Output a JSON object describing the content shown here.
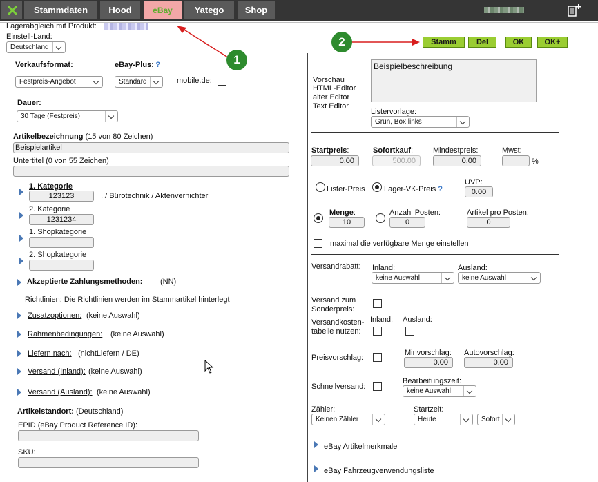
{
  "tabs": [
    {
      "label": "Stammdaten"
    },
    {
      "label": "Hood"
    },
    {
      "label": "eBay"
    },
    {
      "label": "Yatego"
    },
    {
      "label": "Shop"
    }
  ],
  "header": {
    "lagerabgleich_label": "Lagerabgleich mit Produkt:",
    "einstell_land_label": "Einstell-Land:",
    "einstell_land_value": "Deutschland"
  },
  "annotations": {
    "badge1": "1",
    "badge2": "2"
  },
  "buttons": {
    "stamm": "Stamm",
    "del": "Del",
    "ok": "OK",
    "ok_plus": "OK+"
  },
  "left": {
    "verkaufsformat_label": "Verkaufsformat:",
    "verkaufsformat_value": "Festpreis-Angebot",
    "ebayplus_label": "eBay-Plus",
    "ebayplus_q": "?",
    "ebayplus_value": "Standard",
    "mobile_label": "mobile.de:",
    "dauer_label": "Dauer:",
    "dauer_value": "30 Tage (Festpreis)",
    "artikelbez_label": "Artikelbezeichnung",
    "artikelbez_count": "(15 von 80 Zeichen)",
    "artikelbez_value": "Beispielartikel",
    "untertitel_label": "Untertitel (0 von 55 Zeichen)",
    "kat1_label": "1. Kategorie",
    "kat1_value": "123123",
    "kat1_path": "../ Bürotechnik / Aktenvernichter",
    "kat2_label": "2. Kategorie",
    "kat2_value": "1231234",
    "shopkat1_label": "1. Shopkategorie",
    "shopkat2_label": "2. Shopkategorie",
    "zahlung_label": "Akzeptierte Zahlungsmethoden:",
    "zahlung_value": "(NN)",
    "richtlinien_text": "Richtlinien: Die Richtlinien werden im Stammartikel hinterlegt",
    "zusatz_label": "Zusatzoptionen:",
    "zusatz_value": "(keine Auswahl)",
    "rahmen_label": "Rahmenbedingungen:",
    "rahmen_value": "(keine Auswahl)",
    "liefern_label": "Liefern nach:",
    "liefern_value": "(nichtLiefern / DE)",
    "versand_inland_label": "Versand (Inland):",
    "versand_inland_value": "(keine Auswahl)",
    "versand_ausland_label": "Versand (Ausland):",
    "versand_ausland_value": "(keine Auswahl)",
    "standort_label": "Artikelstandort:",
    "standort_value": "(Deutschland)",
    "epid_label": "EPID (eBay Product Reference ID):",
    "sku_label": "SKU:"
  },
  "right": {
    "editor_links": [
      "Vorschau",
      "HTML-Editor",
      "alter Editor",
      "Text Editor"
    ],
    "description_value": "Beispielbeschreibung",
    "listervorlage_label": "Listervorlage:",
    "listervorlage_value": "Grün, Box links",
    "startpreis_label": "Startpreis",
    "startpreis_value": "0.00",
    "sofortkauf_label": "Sofortkauf",
    "sofortkauf_value": "500.00",
    "mindestpreis_label": "Mindestpreis:",
    "mindestpreis_value": "0.00",
    "mwst_label": "Mwst:",
    "mwst_unit": "%",
    "lister_preis_label": "Lister-Preis",
    "lager_vk_label": "Lager-VK-Preis",
    "lager_vk_q": "?",
    "uvp_label": "UVP:",
    "uvp_value": "0.00",
    "menge_label": "Menge",
    "menge_value": "10",
    "anzahl_posten_label": "Anzahl Posten:",
    "anzahl_posten_value": "0",
    "artikel_pro_posten_label": "Artikel pro Posten:",
    "artikel_pro_posten_value": "0",
    "max_menge_label": "maximal die verfügbare Menge einstellen",
    "versandrabatt_label": "Versandrabatt:",
    "inland_label": "Inland:",
    "ausland_label": "Ausland:",
    "rabatt_inland_value": "keine Auswahl",
    "rabatt_ausland_value": "keine Auswahl",
    "sonderpreis_label_1": "Versand zum",
    "sonderpreis_label_2": "Sonderpreis:",
    "vktabelle_label_1": "Versandkosten-",
    "vktabelle_label_2": "tabelle nutzen:",
    "vktabelle_inland_label": "Inland:",
    "vktabelle_ausland_label": "Ausland:",
    "preisvorschlag_label": "Preisvorschlag:",
    "minvorschlag_label": "Minvorschlag:",
    "minvorschlag_value": "0.00",
    "autovorschlag_label": "Autovorschlag:",
    "autovorschlag_value": "0.00",
    "schnellversand_label": "Schnellversand:",
    "bearbeitungszeit_label": "Bearbeitungszeit:",
    "bearbeitungszeit_value": "keine Auswahl",
    "zaehler_label": "Zähler:",
    "zaehler_value": "Keinen Zähler",
    "startzeit_label": "Startzeit:",
    "startzeit_day_value": "Heute",
    "startzeit_time_value": "Sofort",
    "artikelmerkmale_label": "eBay Artikelmerkmale",
    "fahrzeug_label": "eBay Fahrzeugverwendungsliste"
  }
}
